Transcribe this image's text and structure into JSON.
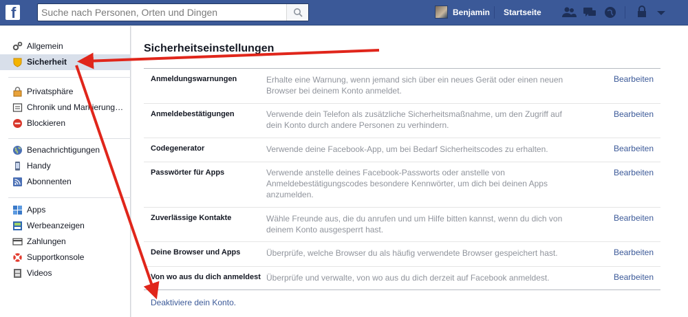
{
  "topbar": {
    "logo": "f",
    "search_placeholder": "Suche nach Personen, Orten und Dingen",
    "user_name": "Benjamin",
    "home_label": "Startseite",
    "icons": [
      "friend-requests-icon",
      "messages-icon",
      "notifications-icon",
      "privacy-shortcuts-icon",
      "account-menu-icon"
    ]
  },
  "sidebar": {
    "items": [
      {
        "label": "Allgemein",
        "icon": "gears-icon",
        "active": false
      },
      {
        "label": "Sicherheit",
        "icon": "shield-icon",
        "active": true
      },
      {
        "label": "Privatsphäre",
        "icon": "lock-icon",
        "active": false
      },
      {
        "label": "Chronik und Markierung…",
        "icon": "timeline-icon",
        "active": false
      },
      {
        "label": "Blockieren",
        "icon": "block-icon",
        "active": false
      },
      {
        "label": "Benachrichtigungen",
        "icon": "globe-icon",
        "active": false
      },
      {
        "label": "Handy",
        "icon": "phone-icon",
        "active": false
      },
      {
        "label": "Abonnenten",
        "icon": "rss-icon",
        "active": false
      },
      {
        "label": "Apps",
        "icon": "apps-icon",
        "active": false
      },
      {
        "label": "Werbeanzeigen",
        "icon": "ads-icon",
        "active": false
      },
      {
        "label": "Zahlungen",
        "icon": "payments-icon",
        "active": false
      },
      {
        "label": "Supportkonsole",
        "icon": "lifebuoy-icon",
        "active": false
      },
      {
        "label": "Videos",
        "icon": "film-icon",
        "active": false
      }
    ]
  },
  "main": {
    "title": "Sicherheitseinstellungen",
    "edit_label": "Bearbeiten",
    "rows": [
      {
        "name": "Anmeldungswarnungen",
        "desc": "Erhalte eine Warnung, wenn jemand sich über ein neues Gerät oder einen neuen Browser bei deinem Konto anmeldet."
      },
      {
        "name": "Anmeldebestätigungen",
        "desc": "Verwende dein Telefon als zusätzliche Sicherheitsmaßnahme, um den Zugriff auf dein Konto durch andere Personen zu verhindern."
      },
      {
        "name": "Codegenerator",
        "desc": "Verwende deine Facebook-App, um bei Bedarf Sicherheitscodes zu erhalten."
      },
      {
        "name": "Passwörter für Apps",
        "desc": "Verwende anstelle deines Facebook-Passworts oder anstelle von Anmeldebestätigungscodes besondere Kennwörter, um dich bei deinen Apps anzumelden."
      },
      {
        "name": "Zuverlässige Kontakte",
        "desc": "Wähle Freunde aus, die du anrufen und um Hilfe bitten kannst, wenn du dich von deinem Konto ausgesperrt hast."
      },
      {
        "name": "Deine Browser und Apps",
        "desc": "Überprüfe, welche Browser du als häufig verwendete Browser gespeichert hast."
      },
      {
        "name": "Von wo aus du dich anmeldest",
        "desc": "Überprüfe und verwalte, von wo aus du dich derzeit auf Facebook anmeldest."
      }
    ],
    "deactivate_label": "Deaktiviere dein Konto."
  },
  "colors": {
    "brand": "#3b5998",
    "arrow": "#e0261b",
    "active_nav": "#d8dfea"
  }
}
